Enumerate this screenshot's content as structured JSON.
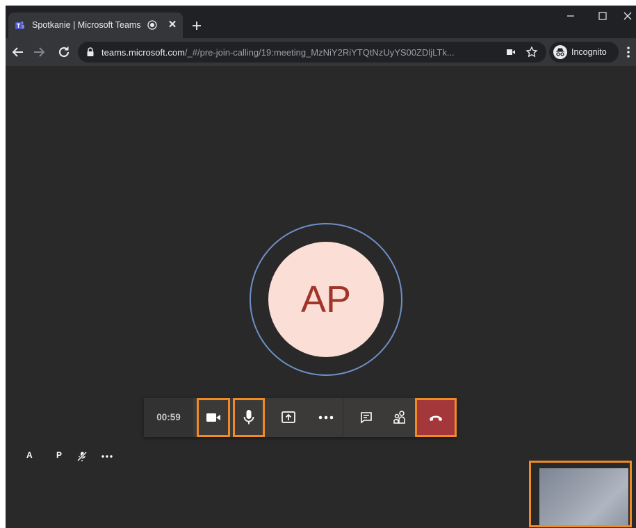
{
  "browser": {
    "tab": {
      "title": "Spotkanie | Microsoft Teams",
      "close_icon": "close-icon"
    },
    "address_bar": {
      "host": "teams.microsoft.com",
      "path": "/_#/pre-join-calling/19:meeting_MzNiY2RiYTQtNzUyYS00ZDljLTk..."
    },
    "profile_label": "Incognito"
  },
  "call": {
    "avatar_initials": "AP",
    "timer": "00:59",
    "controls": [
      "camera-icon",
      "microphone-icon",
      "share-screen-icon",
      "more-options-icon",
      "chat-icon",
      "participants-icon",
      "hang-up-icon"
    ]
  },
  "participants": [
    {
      "label": "A"
    },
    {
      "label": "P"
    }
  ],
  "colors": {
    "stage_bg": "#292929",
    "callbar_bg": "#3b3a39",
    "hangup": "#a4373a",
    "avatar_bg": "#fbdfd6",
    "avatar_text": "#a0342b",
    "ring": "#6f8fc7",
    "highlight": "#f08a24"
  }
}
